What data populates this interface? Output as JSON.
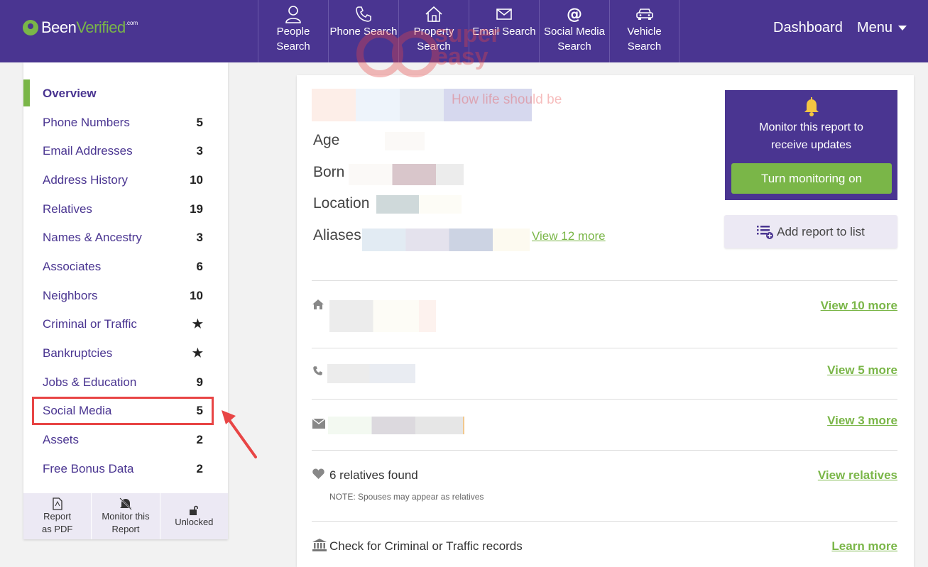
{
  "brand": {
    "name_prefix": "Been",
    "name_accent": "Verified",
    "suffix": ".com"
  },
  "nav": {
    "tabs": [
      {
        "label": "People Search",
        "icon": "person-icon"
      },
      {
        "label": "Phone Search",
        "icon": "phone-icon"
      },
      {
        "label": "Property Search",
        "icon": "house-icon"
      },
      {
        "label": "Email Search",
        "icon": "envelope-icon"
      },
      {
        "label": "Social Media Search",
        "icon": "at-icon"
      },
      {
        "label": "Vehicle Search",
        "icon": "car-icon"
      }
    ],
    "dashboard": "Dashboard",
    "menu": "Menu"
  },
  "sidebar": {
    "items": [
      {
        "label": "Overview",
        "count": ""
      },
      {
        "label": "Phone Numbers",
        "count": "5"
      },
      {
        "label": "Email Addresses",
        "count": "3"
      },
      {
        "label": "Address History",
        "count": "10"
      },
      {
        "label": "Relatives",
        "count": "19"
      },
      {
        "label": "Names & Ancestry",
        "count": "3"
      },
      {
        "label": "Associates",
        "count": "6"
      },
      {
        "label": "Neighbors",
        "count": "10"
      },
      {
        "label": "Criminal or Traffic",
        "count": "★"
      },
      {
        "label": "Bankruptcies",
        "count": "★"
      },
      {
        "label": "Jobs & Education",
        "count": "9"
      },
      {
        "label": "Social Media",
        "count": "5"
      },
      {
        "label": "Assets",
        "count": "2"
      },
      {
        "label": "Free Bonus Data",
        "count": "2"
      }
    ],
    "bottom": {
      "pdf": "Report as PDF",
      "monitor": "Monitor this Report",
      "unlocked": "Unlocked"
    }
  },
  "report": {
    "age_label": "Age",
    "born_label": "Born",
    "location_label": "Location",
    "aliases_label": "Aliases",
    "aliases_more": "View 12 more",
    "monitor_text": "Monitor this report to receive updates",
    "monitor_button": "Turn monitoring on",
    "add_to_list": "Add report to list",
    "address_more": "View 10 more",
    "phone_more": "View 5 more",
    "email_more": "View 3 more",
    "relatives_text": "6 relatives found",
    "relatives_note": "NOTE: Spouses may appear as relatives",
    "relatives_link": "View relatives",
    "criminal_text": "Check for Criminal or Traffic records",
    "criminal_link": "Learn more"
  },
  "watermark": {
    "line1": "super",
    "line2": "easy",
    "tagline": "How life should be"
  },
  "colors": {
    "brand_purple": "#4a3591",
    "accent_green": "#7ab648",
    "highlight_red": "#e84545"
  }
}
